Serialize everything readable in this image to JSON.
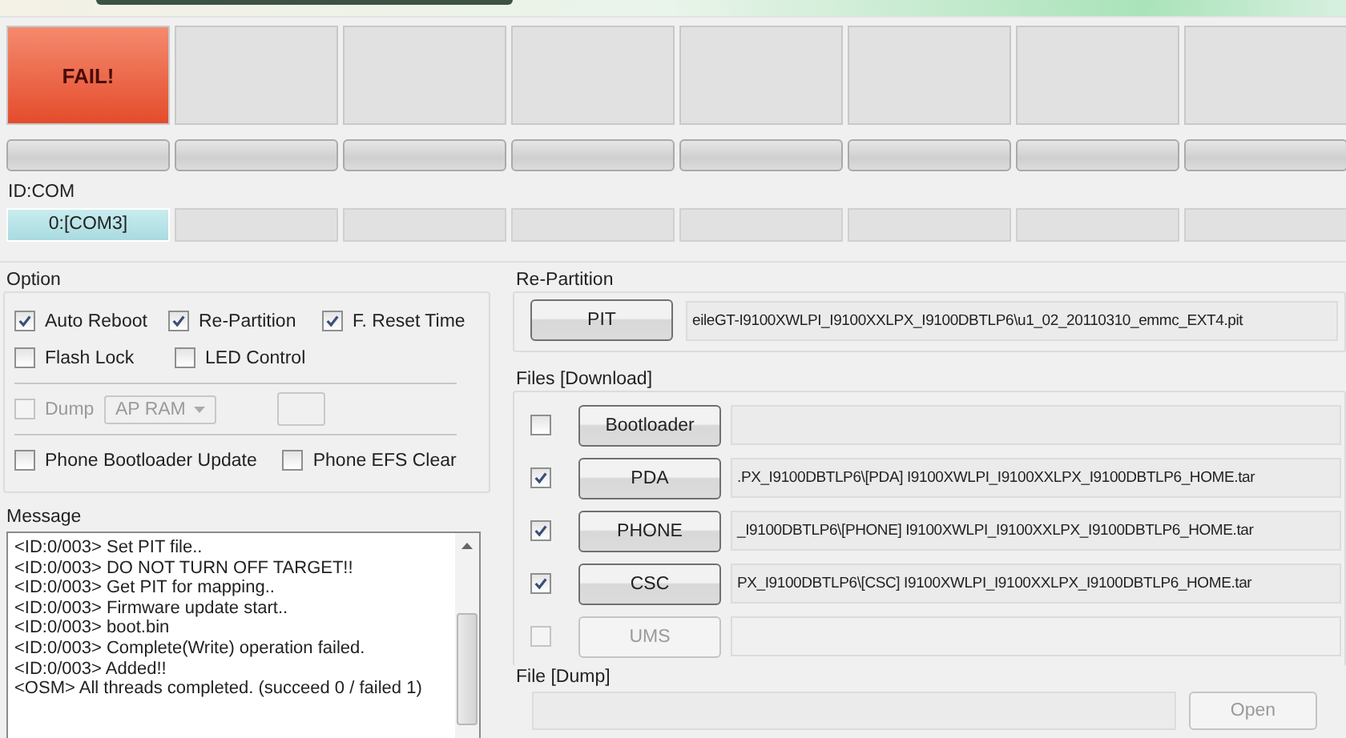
{
  "status_slots": [
    {
      "kind": "fail",
      "text": "FAIL!"
    },
    {
      "kind": "empty"
    },
    {
      "kind": "empty"
    },
    {
      "kind": "empty"
    },
    {
      "kind": "empty"
    },
    {
      "kind": "empty"
    },
    {
      "kind": "empty"
    },
    {
      "kind": "empty"
    }
  ],
  "progress_bars": [
    {
      "level": 0
    },
    {
      "level": 0
    },
    {
      "level": 0
    },
    {
      "level": 0
    },
    {
      "level": 0
    },
    {
      "level": 0
    },
    {
      "level": 0
    },
    {
      "level": 0
    }
  ],
  "id_com": {
    "label": "ID:COM",
    "ports": [
      {
        "text": "0:[COM3]",
        "selected": true
      },
      {
        "selected": false
      },
      {
        "selected": false
      },
      {
        "selected": false
      },
      {
        "selected": false
      },
      {
        "selected": false
      },
      {
        "selected": false
      },
      {
        "selected": false
      }
    ]
  },
  "option": {
    "title": "Option",
    "rows": [
      [
        {
          "label": "Auto Reboot",
          "checked": true
        },
        {
          "label": "Re-Partition",
          "checked": true
        },
        {
          "label": "F. Reset Time",
          "checked": true
        }
      ],
      [
        {
          "label": "Flash Lock",
          "checked": false
        },
        {
          "label": "LED Control",
          "checked": false
        }
      ]
    ],
    "dump": {
      "label": "Dump",
      "checked": false,
      "disabled": true,
      "dropdown": "AP RAM"
    },
    "phone_options": [
      {
        "label": "Phone Bootloader Update",
        "checked": false
      },
      {
        "label": "Phone EFS Clear",
        "checked": false
      }
    ]
  },
  "message": {
    "title": "Message",
    "lines": [
      "<ID:0/003> Set PIT file..",
      "<ID:0/003> DO NOT TURN OFF TARGET!!",
      "<ID:0/003> Get PIT for mapping..",
      "<ID:0/003> Firmware update start..",
      "<ID:0/003> boot.bin",
      "<ID:0/003> Complete(Write) operation failed.",
      "<ID:0/003> Added!!",
      "<OSM> All threads completed. (succeed 0 / failed 1)"
    ]
  },
  "re_partition": {
    "title": "Re-Partition",
    "button": "PIT",
    "path": "eileGT-I9100XWLPI_I9100XXLPX_I9100DBTLP6\\u1_02_20110310_emmc_EXT4.pit"
  },
  "files_download": {
    "title": "Files [Download]",
    "rows": [
      {
        "button": "Bootloader",
        "checked": false,
        "disabled": false
      },
      {
        "button": "PDA",
        "checked": true,
        "disabled": false,
        "path": ".PX_I9100DBTLP6\\[PDA] I9100XWLPI_I9100XXLPX_I9100DBTLP6_HOME.tar"
      },
      {
        "button": "PHONE",
        "checked": true,
        "disabled": false,
        "path": "_I9100DBTLP6\\[PHONE] I9100XWLPI_I9100XXLPX_I9100DBTLP6_HOME.tar"
      },
      {
        "button": "CSC",
        "checked": true,
        "disabled": false,
        "path": "PX_I9100DBTLP6\\[CSC] I9100XWLPI_I9100XXLPX_I9100DBTLP6_HOME.tar"
      },
      {
        "button": "UMS",
        "checked": false,
        "disabled": true
      }
    ]
  },
  "file_dump": {
    "title": "File [Dump]",
    "button": "Open",
    "disabled": true
  }
}
